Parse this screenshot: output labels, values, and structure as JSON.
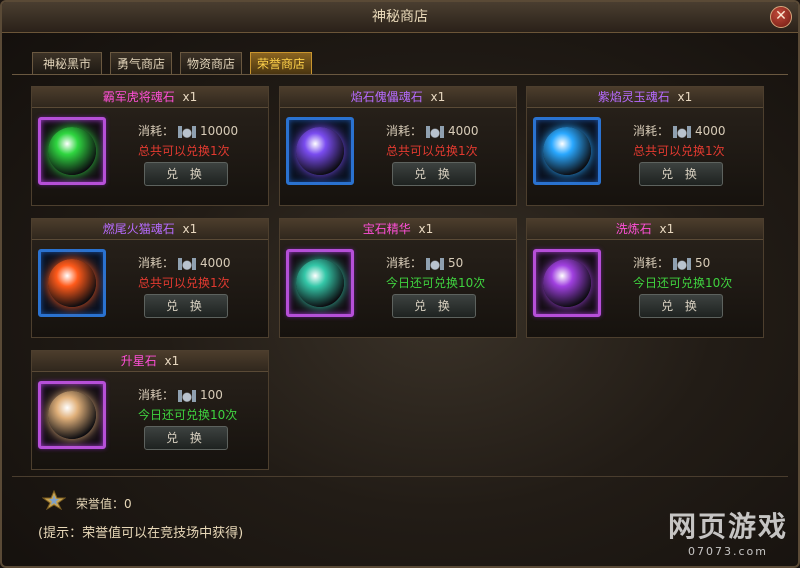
{
  "window": {
    "title": "神秘商店",
    "close_symbol": "✕"
  },
  "tabs": [
    {
      "label": "神秘黑市",
      "active": false
    },
    {
      "label": "勇气商店",
      "active": false
    },
    {
      "label": "物资商店",
      "active": false
    },
    {
      "label": "荣誉商店",
      "active": true
    }
  ],
  "cost_label": "消耗：",
  "exchange_label": "兑 换",
  "items": [
    {
      "name": "霸军虎将魂石",
      "qty": "x1",
      "name_color": "#ff4fd8",
      "cost": "10000",
      "limit": "总共可以兑换1次",
      "limit_type": "red",
      "frame": "purple",
      "icon": "green-leaf-soul-stone-icon",
      "gem_color": "#2fd640"
    },
    {
      "name": "焰石傀儡魂石",
      "qty": "x1",
      "name_color": "#b66bff",
      "cost": "4000",
      "limit": "总共可以兑换1次",
      "limit_type": "red",
      "frame": "blue",
      "icon": "purple-swirl-soul-stone-icon",
      "gem_color": "#7a4cf0"
    },
    {
      "name": "紫焰灵玉魂石",
      "qty": "x1",
      "name_color": "#b66bff",
      "cost": "4000",
      "limit": "总共可以兑换1次",
      "limit_type": "red",
      "frame": "blue",
      "icon": "blue-drop-soul-stone-icon",
      "gem_color": "#2aa8ff"
    },
    {
      "name": "燃尾火猫魂石",
      "qty": "x1",
      "name_color": "#b66bff",
      "cost": "4000",
      "limit": "总共可以兑换1次",
      "limit_type": "red",
      "frame": "blue",
      "icon": "fire-soul-stone-icon",
      "gem_color": "#ff5a1a"
    },
    {
      "name": "宝石精华",
      "qty": "x1",
      "name_color": "#ff4fd8",
      "cost": "50",
      "limit": "今日还可兑换10次",
      "limit_type": "green",
      "frame": "purple",
      "icon": "gem-essence-egg-icon",
      "gem_color": "#34c7a8"
    },
    {
      "name": "洗炼石",
      "qty": "x1",
      "name_color": "#ff4fd8",
      "cost": "50",
      "limit": "今日还可兑换10次",
      "limit_type": "green",
      "frame": "purple",
      "icon": "refining-orb-icon",
      "gem_color": "#a040e0"
    },
    {
      "name": "升星石",
      "qty": "x1",
      "name_color": "#ff4fd8",
      "cost": "100",
      "limit": "今日还可兑换10次",
      "limit_type": "green",
      "frame": "purple",
      "icon": "star-up-stone-icon",
      "gem_color": "#e0b07a"
    }
  ],
  "footer": {
    "honor_label": "荣誉值：0",
    "tip": "(提示：荣誉值可以在竞技场中获得)"
  },
  "watermark": {
    "big": "网页游戏",
    "small": "07073.com"
  }
}
